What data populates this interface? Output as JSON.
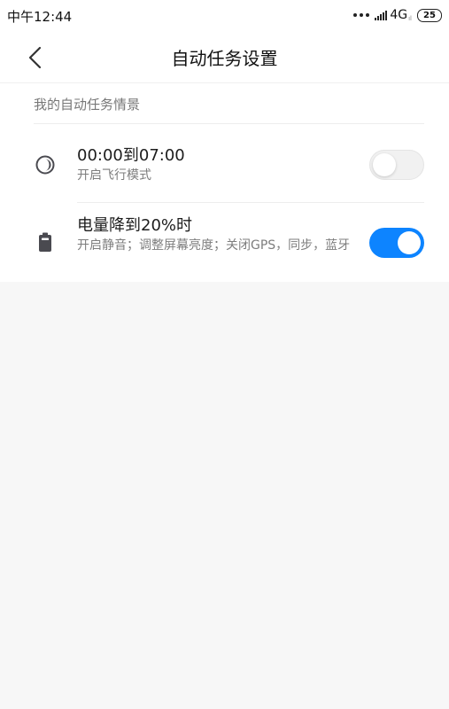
{
  "status_bar": {
    "time": "中午12:44",
    "network": "4G",
    "network_sub": "ıl",
    "battery": "25"
  },
  "header": {
    "title": "自动任务设置",
    "back_icon": "chevron-left-icon"
  },
  "section": {
    "title": "我的自动任务情景"
  },
  "tasks": [
    {
      "title": "00:00到07:00",
      "description": "开启飞行模式",
      "icon": "moon-icon",
      "enabled": false
    },
    {
      "title": "电量降到20%时",
      "description": "开启静音；调整屏幕亮度；关闭GPS，同步，蓝牙",
      "icon": "battery-icon",
      "enabled": true
    }
  ],
  "colors": {
    "accent": "#0d84ff",
    "page_background": "#f7f7f7",
    "card_background": "#ffffff"
  }
}
